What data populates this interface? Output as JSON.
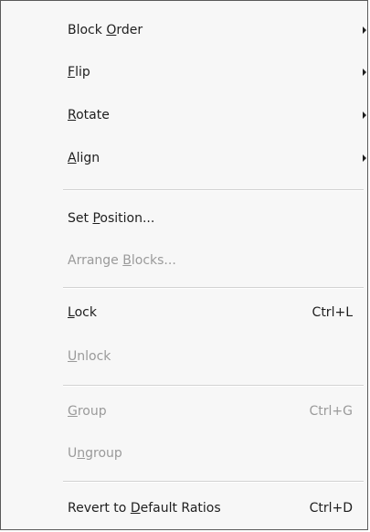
{
  "menu": {
    "items": [
      {
        "pre": "Block ",
        "key": "O",
        "post": "rder",
        "shortcut": "",
        "submenu": true,
        "enabled": true
      },
      {
        "pre": "",
        "key": "F",
        "post": "lip",
        "shortcut": "",
        "submenu": true,
        "enabled": true
      },
      {
        "pre": "",
        "key": "R",
        "post": "otate",
        "shortcut": "",
        "submenu": true,
        "enabled": true
      },
      {
        "pre": "",
        "key": "A",
        "post": "lign",
        "shortcut": "",
        "submenu": true,
        "enabled": true
      },
      {
        "pre": "Set ",
        "key": "P",
        "post": "osition...",
        "shortcut": "",
        "submenu": false,
        "enabled": true
      },
      {
        "pre": "Arrange ",
        "key": "B",
        "post": "locks...",
        "shortcut": "",
        "submenu": false,
        "enabled": false
      },
      {
        "pre": "",
        "key": "L",
        "post": "ock",
        "shortcut": "Ctrl+L",
        "submenu": false,
        "enabled": true
      },
      {
        "pre": "",
        "key": "U",
        "post": "nlock",
        "shortcut": "",
        "submenu": false,
        "enabled": false
      },
      {
        "pre": "",
        "key": "G",
        "post": "roup",
        "shortcut": "Ctrl+G",
        "submenu": false,
        "enabled": false
      },
      {
        "pre": "U",
        "key": "n",
        "post": "group",
        "shortcut": "",
        "submenu": false,
        "enabled": false
      },
      {
        "pre": "Revert to ",
        "key": "D",
        "post": "efault Ratios",
        "shortcut": "Ctrl+D",
        "submenu": false,
        "enabled": true
      }
    ]
  },
  "colors": {
    "enabled_text": "#1e1e1e",
    "disabled_text": "#9a9a9a",
    "background": "#f7f7f7",
    "border": "#5a5a5a"
  }
}
